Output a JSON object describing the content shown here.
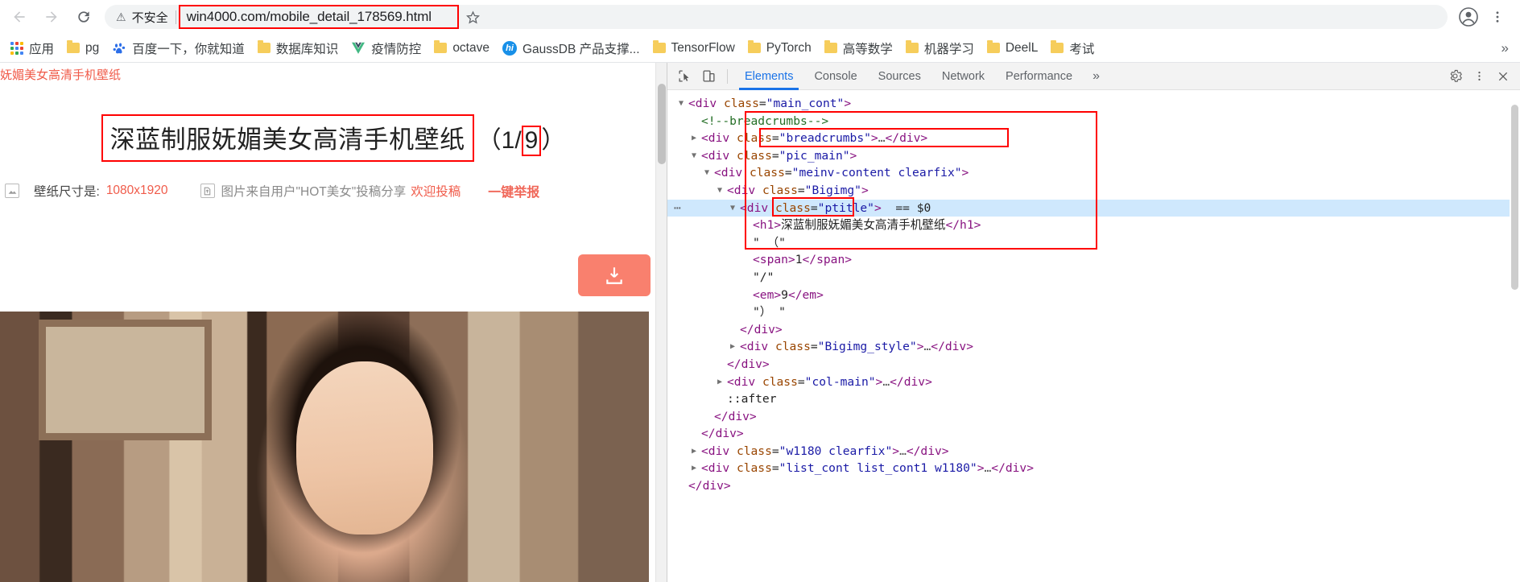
{
  "browser": {
    "nav": {
      "back_label": "Back",
      "forward_label": "Forward",
      "reload_label": "Reload"
    },
    "omnibox": {
      "security_label": "不安全",
      "security_icon": "warning-triangle-icon",
      "url": "win4000.com/mobile_detail_178569.html",
      "url_domain": "win4000.com",
      "url_path": "/mobile_detail_178569.html",
      "star_icon": "bookmark-star-icon",
      "profile_icon": "profile-avatar-icon",
      "menu_icon": "three-dot-menu-icon",
      "highlight_color": "#ff0000"
    },
    "bookmarks": [
      {
        "label": "应用",
        "icon": "apps-grid-icon"
      },
      {
        "label": "pg",
        "icon": "folder-icon"
      },
      {
        "label": "百度一下，你就知道",
        "icon": "baidu-paw-icon"
      },
      {
        "label": "数据库知识",
        "icon": "folder-icon"
      },
      {
        "label": "疫情防控",
        "icon": "vue-logo-icon"
      },
      {
        "label": "octave",
        "icon": "folder-icon"
      },
      {
        "label": "GaussDB 产品支撑...",
        "icon": "gaussdb-icon"
      },
      {
        "label": "TensorFlow",
        "icon": "folder-icon"
      },
      {
        "label": "PyTorch",
        "icon": "folder-icon"
      },
      {
        "label": "高等数学",
        "icon": "folder-icon"
      },
      {
        "label": "机器学习",
        "icon": "folder-icon"
      },
      {
        "label": "DeelL",
        "icon": "folder-icon"
      },
      {
        "label": "考试",
        "icon": "folder-icon"
      }
    ],
    "bookmarks_overflow_label": "»"
  },
  "page": {
    "breadcrumb": "妩媚美女高清手机壁纸",
    "title": "深蓝制服妩媚美女高清手机壁纸",
    "counter_open": "（",
    "counter_current": "1",
    "counter_sep": "/",
    "counter_total": "9",
    "counter_close": "）",
    "size_label": "壁纸尺寸是:",
    "size_value": "1080x1920",
    "size_icon": "image-size-icon",
    "source_icon": "upload-source-icon",
    "source_text": "图片来自用户\"HOT美女\"投稿分享",
    "source_link": "欢迎投稿",
    "report_label": "一键举报",
    "download_icon": "download-icon",
    "accent_red": "#f05b4a",
    "accent_orange": "#f9806e"
  },
  "devtools": {
    "inspect_icon": "inspect-element-icon",
    "device_icon": "device-toolbar-icon",
    "tabs": [
      {
        "label": "Elements",
        "active": true
      },
      {
        "label": "Console",
        "active": false
      },
      {
        "label": "Sources",
        "active": false
      },
      {
        "label": "Network",
        "active": false
      },
      {
        "label": "Performance",
        "active": false
      }
    ],
    "more_tabs_label": "»",
    "settings_icon": "gear-icon",
    "kebab_icon": "three-dot-menu-icon",
    "close_icon": "close-icon",
    "selected_suffix": "== $0",
    "dom_rows": [
      {
        "indent": 0,
        "tri": "open",
        "parts": [
          [
            "tag",
            "<div "
          ],
          [
            "attr",
            "class"
          ],
          [
            "eq",
            "="
          ],
          [
            "val",
            "\"main_cont\""
          ],
          [
            "tag",
            ">"
          ]
        ]
      },
      {
        "indent": 1,
        "tri": "none",
        "parts": [
          [
            "cmt",
            "<!--breadcrumbs-->"
          ]
        ]
      },
      {
        "indent": 1,
        "tri": "closed",
        "parts": [
          [
            "tag",
            "<div "
          ],
          [
            "attr",
            "class"
          ],
          [
            "eq",
            "="
          ],
          [
            "val",
            "\"breadcrumbs\""
          ],
          [
            "tag",
            ">"
          ],
          [
            "dotdot",
            "…"
          ],
          [
            "tag",
            "</div>"
          ]
        ]
      },
      {
        "indent": 1,
        "tri": "open",
        "parts": [
          [
            "tag",
            "<div "
          ],
          [
            "attr",
            "class"
          ],
          [
            "eq",
            "="
          ],
          [
            "val",
            "\"pic_main\""
          ],
          [
            "tag",
            ">"
          ]
        ]
      },
      {
        "indent": 2,
        "tri": "open",
        "parts": [
          [
            "tag",
            "<div "
          ],
          [
            "attr",
            "class"
          ],
          [
            "eq",
            "="
          ],
          [
            "val",
            "\"meinv-content clearfix\""
          ],
          [
            "tag",
            ">"
          ]
        ]
      },
      {
        "indent": 3,
        "tri": "open",
        "parts": [
          [
            "tag",
            "<div "
          ],
          [
            "attr",
            "class"
          ],
          [
            "eq",
            "="
          ],
          [
            "val",
            "\"Bigimg\""
          ],
          [
            "tag",
            ">"
          ]
        ]
      },
      {
        "indent": 4,
        "tri": "open",
        "selected": true,
        "parts": [
          [
            "tag",
            "<div "
          ],
          [
            "attr",
            "class"
          ],
          [
            "eq",
            "="
          ],
          [
            "val",
            "\"ptitle\""
          ],
          [
            "tag",
            ">"
          ],
          [
            "txt",
            "  == $0"
          ]
        ]
      },
      {
        "indent": 5,
        "tri": "none",
        "parts": [
          [
            "tag",
            "<h1>"
          ],
          [
            "txt",
            "深蓝制服妩媚美女高清手机壁纸"
          ],
          [
            "tag",
            "</h1>"
          ]
        ]
      },
      {
        "indent": 5,
        "tri": "none",
        "parts": [
          [
            "txt",
            "\" （\""
          ]
        ]
      },
      {
        "indent": 5,
        "tri": "none",
        "parts": [
          [
            "tag",
            "<span>"
          ],
          [
            "txt",
            "1"
          ],
          [
            "tag",
            "</span>"
          ]
        ]
      },
      {
        "indent": 5,
        "tri": "none",
        "parts": [
          [
            "txt",
            "\"/\""
          ]
        ]
      },
      {
        "indent": 5,
        "tri": "none",
        "parts": [
          [
            "tag",
            "<em>"
          ],
          [
            "txt",
            "9"
          ],
          [
            "tag",
            "</em>"
          ]
        ]
      },
      {
        "indent": 5,
        "tri": "none",
        "parts": [
          [
            "txt",
            "\"） \""
          ]
        ]
      },
      {
        "indent": 4,
        "tri": "none",
        "parts": [
          [
            "tag",
            "</div>"
          ]
        ]
      },
      {
        "indent": 4,
        "tri": "closed",
        "parts": [
          [
            "tag",
            "<div "
          ],
          [
            "attr",
            "class"
          ],
          [
            "eq",
            "="
          ],
          [
            "val",
            "\"Bigimg_style\""
          ],
          [
            "tag",
            ">"
          ],
          [
            "dotdot",
            "…"
          ],
          [
            "tag",
            "</div>"
          ]
        ]
      },
      {
        "indent": 3,
        "tri": "none",
        "parts": [
          [
            "tag",
            "</div>"
          ]
        ]
      },
      {
        "indent": 3,
        "tri": "closed",
        "parts": [
          [
            "tag",
            "<div "
          ],
          [
            "attr",
            "class"
          ],
          [
            "eq",
            "="
          ],
          [
            "val",
            "\"col-main\""
          ],
          [
            "tag",
            ">"
          ],
          [
            "dotdot",
            "…"
          ],
          [
            "tag",
            "</div>"
          ]
        ]
      },
      {
        "indent": 3,
        "tri": "none",
        "parts": [
          [
            "txt",
            "::after"
          ]
        ]
      },
      {
        "indent": 2,
        "tri": "none",
        "parts": [
          [
            "tag",
            "</div>"
          ]
        ]
      },
      {
        "indent": 1,
        "tri": "none",
        "parts": [
          [
            "tag",
            "</div>"
          ]
        ]
      },
      {
        "indent": 1,
        "tri": "closed",
        "parts": [
          [
            "tag",
            "<div "
          ],
          [
            "attr",
            "class"
          ],
          [
            "eq",
            "="
          ],
          [
            "val",
            "\"w1180 clearfix\""
          ],
          [
            "tag",
            ">"
          ],
          [
            "dotdot",
            "…"
          ],
          [
            "tag",
            "</div>"
          ]
        ]
      },
      {
        "indent": 1,
        "tri": "closed",
        "parts": [
          [
            "tag",
            "<div "
          ],
          [
            "attr",
            "class"
          ],
          [
            "eq",
            "="
          ],
          [
            "val",
            "\"list_cont list_cont1 w1180\""
          ],
          [
            "tag",
            ">"
          ],
          [
            "dotdot",
            "…"
          ],
          [
            "tag",
            "</div>"
          ]
        ]
      },
      {
        "indent": 0,
        "tri": "none",
        "parts": [
          [
            "tag",
            "</div>"
          ]
        ]
      }
    ]
  }
}
